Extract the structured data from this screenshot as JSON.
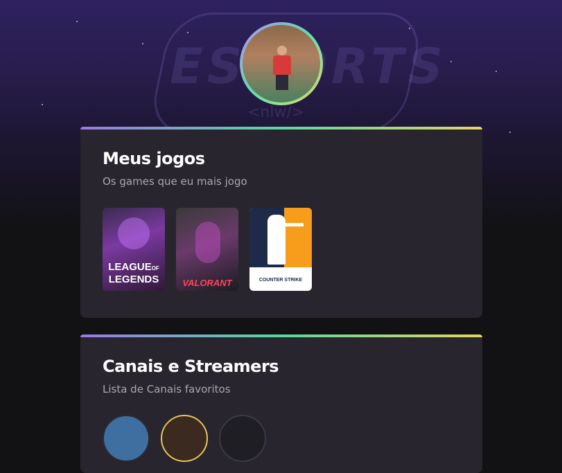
{
  "profile": {
    "avatar_icon": "profile-photo"
  },
  "background": {
    "logo_text": "ESPORTS",
    "logo_sub": "<nlw/>"
  },
  "games_section": {
    "title": "Meus jogos",
    "subtitle": "Os games que eu mais jogo",
    "games": [
      {
        "label": "LEAGUE OF LEGENDS",
        "line1": "LEAGUE",
        "line2": "LEGENDS",
        "of": "OF",
        "accent": "#7a3aa0"
      },
      {
        "label": "VALORANT",
        "accent": "#ff4655"
      },
      {
        "label": "COUNTER STRIKE",
        "accent": "#f79d1b"
      }
    ]
  },
  "channels_section": {
    "title": "Canais e Streamers",
    "subtitle": "Lista de Canais favoritos",
    "channels": [
      {
        "icon": "crown-channel-icon"
      },
      {
        "icon": "streamer-avatar"
      },
      {
        "icon": "purple-channel-icon"
      }
    ]
  },
  "colors": {
    "gradient_start": "#9a78e8",
    "gradient_mid": "#5ad8a0",
    "gradient_end": "#e6d664",
    "card_bg": "#29252f",
    "page_bg": "#121214"
  }
}
